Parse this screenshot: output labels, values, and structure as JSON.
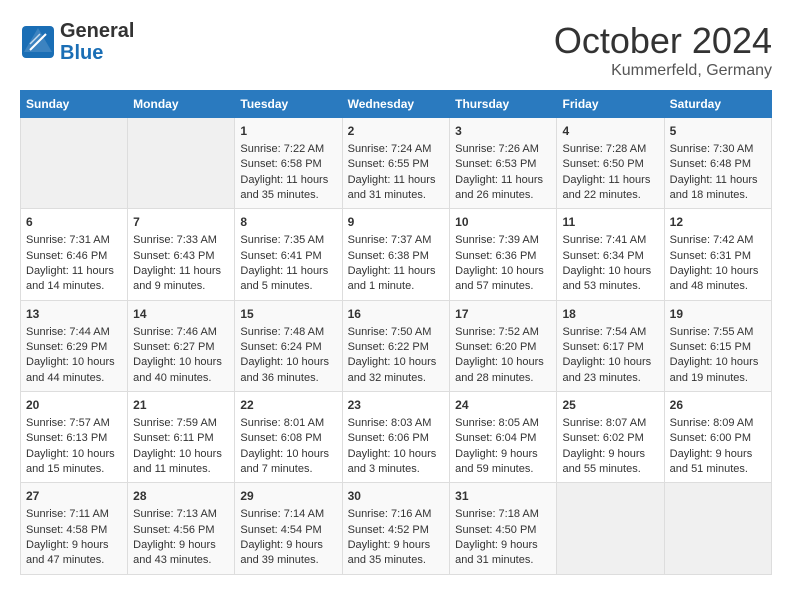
{
  "header": {
    "logo_line1": "General",
    "logo_line2": "Blue",
    "month": "October 2024",
    "location": "Kummerfeld, Germany"
  },
  "columns": [
    "Sunday",
    "Monday",
    "Tuesday",
    "Wednesday",
    "Thursday",
    "Friday",
    "Saturday"
  ],
  "weeks": [
    [
      {
        "day": "",
        "sunrise": "",
        "sunset": "",
        "daylight": ""
      },
      {
        "day": "",
        "sunrise": "",
        "sunset": "",
        "daylight": ""
      },
      {
        "day": "1",
        "sunrise": "Sunrise: 7:22 AM",
        "sunset": "Sunset: 6:58 PM",
        "daylight": "Daylight: 11 hours and 35 minutes."
      },
      {
        "day": "2",
        "sunrise": "Sunrise: 7:24 AM",
        "sunset": "Sunset: 6:55 PM",
        "daylight": "Daylight: 11 hours and 31 minutes."
      },
      {
        "day": "3",
        "sunrise": "Sunrise: 7:26 AM",
        "sunset": "Sunset: 6:53 PM",
        "daylight": "Daylight: 11 hours and 26 minutes."
      },
      {
        "day": "4",
        "sunrise": "Sunrise: 7:28 AM",
        "sunset": "Sunset: 6:50 PM",
        "daylight": "Daylight: 11 hours and 22 minutes."
      },
      {
        "day": "5",
        "sunrise": "Sunrise: 7:30 AM",
        "sunset": "Sunset: 6:48 PM",
        "daylight": "Daylight: 11 hours and 18 minutes."
      }
    ],
    [
      {
        "day": "6",
        "sunrise": "Sunrise: 7:31 AM",
        "sunset": "Sunset: 6:46 PM",
        "daylight": "Daylight: 11 hours and 14 minutes."
      },
      {
        "day": "7",
        "sunrise": "Sunrise: 7:33 AM",
        "sunset": "Sunset: 6:43 PM",
        "daylight": "Daylight: 11 hours and 9 minutes."
      },
      {
        "day": "8",
        "sunrise": "Sunrise: 7:35 AM",
        "sunset": "Sunset: 6:41 PM",
        "daylight": "Daylight: 11 hours and 5 minutes."
      },
      {
        "day": "9",
        "sunrise": "Sunrise: 7:37 AM",
        "sunset": "Sunset: 6:38 PM",
        "daylight": "Daylight: 11 hours and 1 minute."
      },
      {
        "day": "10",
        "sunrise": "Sunrise: 7:39 AM",
        "sunset": "Sunset: 6:36 PM",
        "daylight": "Daylight: 10 hours and 57 minutes."
      },
      {
        "day": "11",
        "sunrise": "Sunrise: 7:41 AM",
        "sunset": "Sunset: 6:34 PM",
        "daylight": "Daylight: 10 hours and 53 minutes."
      },
      {
        "day": "12",
        "sunrise": "Sunrise: 7:42 AM",
        "sunset": "Sunset: 6:31 PM",
        "daylight": "Daylight: 10 hours and 48 minutes."
      }
    ],
    [
      {
        "day": "13",
        "sunrise": "Sunrise: 7:44 AM",
        "sunset": "Sunset: 6:29 PM",
        "daylight": "Daylight: 10 hours and 44 minutes."
      },
      {
        "day": "14",
        "sunrise": "Sunrise: 7:46 AM",
        "sunset": "Sunset: 6:27 PM",
        "daylight": "Daylight: 10 hours and 40 minutes."
      },
      {
        "day": "15",
        "sunrise": "Sunrise: 7:48 AM",
        "sunset": "Sunset: 6:24 PM",
        "daylight": "Daylight: 10 hours and 36 minutes."
      },
      {
        "day": "16",
        "sunrise": "Sunrise: 7:50 AM",
        "sunset": "Sunset: 6:22 PM",
        "daylight": "Daylight: 10 hours and 32 minutes."
      },
      {
        "day": "17",
        "sunrise": "Sunrise: 7:52 AM",
        "sunset": "Sunset: 6:20 PM",
        "daylight": "Daylight: 10 hours and 28 minutes."
      },
      {
        "day": "18",
        "sunrise": "Sunrise: 7:54 AM",
        "sunset": "Sunset: 6:17 PM",
        "daylight": "Daylight: 10 hours and 23 minutes."
      },
      {
        "day": "19",
        "sunrise": "Sunrise: 7:55 AM",
        "sunset": "Sunset: 6:15 PM",
        "daylight": "Daylight: 10 hours and 19 minutes."
      }
    ],
    [
      {
        "day": "20",
        "sunrise": "Sunrise: 7:57 AM",
        "sunset": "Sunset: 6:13 PM",
        "daylight": "Daylight: 10 hours and 15 minutes."
      },
      {
        "day": "21",
        "sunrise": "Sunrise: 7:59 AM",
        "sunset": "Sunset: 6:11 PM",
        "daylight": "Daylight: 10 hours and 11 minutes."
      },
      {
        "day": "22",
        "sunrise": "Sunrise: 8:01 AM",
        "sunset": "Sunset: 6:08 PM",
        "daylight": "Daylight: 10 hours and 7 minutes."
      },
      {
        "day": "23",
        "sunrise": "Sunrise: 8:03 AM",
        "sunset": "Sunset: 6:06 PM",
        "daylight": "Daylight: 10 hours and 3 minutes."
      },
      {
        "day": "24",
        "sunrise": "Sunrise: 8:05 AM",
        "sunset": "Sunset: 6:04 PM",
        "daylight": "Daylight: 9 hours and 59 minutes."
      },
      {
        "day": "25",
        "sunrise": "Sunrise: 8:07 AM",
        "sunset": "Sunset: 6:02 PM",
        "daylight": "Daylight: 9 hours and 55 minutes."
      },
      {
        "day": "26",
        "sunrise": "Sunrise: 8:09 AM",
        "sunset": "Sunset: 6:00 PM",
        "daylight": "Daylight: 9 hours and 51 minutes."
      }
    ],
    [
      {
        "day": "27",
        "sunrise": "Sunrise: 7:11 AM",
        "sunset": "Sunset: 4:58 PM",
        "daylight": "Daylight: 9 hours and 47 minutes."
      },
      {
        "day": "28",
        "sunrise": "Sunrise: 7:13 AM",
        "sunset": "Sunset: 4:56 PM",
        "daylight": "Daylight: 9 hours and 43 minutes."
      },
      {
        "day": "29",
        "sunrise": "Sunrise: 7:14 AM",
        "sunset": "Sunset: 4:54 PM",
        "daylight": "Daylight: 9 hours and 39 minutes."
      },
      {
        "day": "30",
        "sunrise": "Sunrise: 7:16 AM",
        "sunset": "Sunset: 4:52 PM",
        "daylight": "Daylight: 9 hours and 35 minutes."
      },
      {
        "day": "31",
        "sunrise": "Sunrise: 7:18 AM",
        "sunset": "Sunset: 4:50 PM",
        "daylight": "Daylight: 9 hours and 31 minutes."
      },
      {
        "day": "",
        "sunrise": "",
        "sunset": "",
        "daylight": ""
      },
      {
        "day": "",
        "sunrise": "",
        "sunset": "",
        "daylight": ""
      }
    ]
  ]
}
